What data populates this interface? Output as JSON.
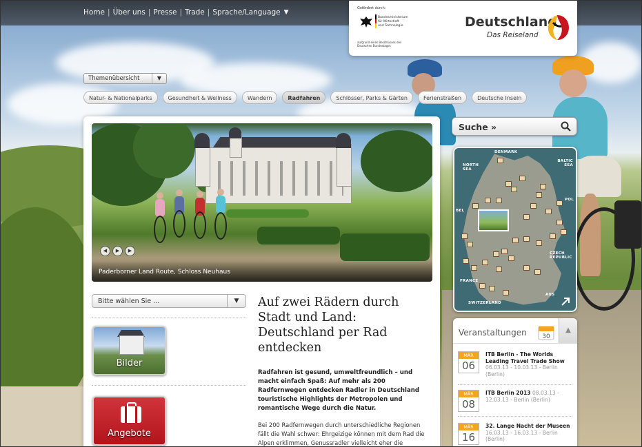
{
  "topnav": {
    "items": [
      "Home",
      "Über uns",
      "Presse",
      "Trade",
      "Sprache/Language"
    ]
  },
  "brand": {
    "funded_by": "Gefördert durch:",
    "ministry": "Bundesministerium für Wirtschaft und Technologie",
    "decision_note": "aufgrund eines Beschlusses des Deutschen Bundestages",
    "title": "Deutschland",
    "subtitle": "Das Reiseland"
  },
  "themes": {
    "selector_label": "Themenübersicht",
    "pills": [
      "Natur- & Nationalparks",
      "Gesundheit & Wellness",
      "Wandern",
      "Radfahren",
      "Schlösser, Parks & Gärten",
      "Ferienstraßen",
      "Deutsche Inseln"
    ],
    "active": "Radfahren"
  },
  "hero": {
    "caption": "Paderborner Land Route, Schloss Neuhaus"
  },
  "select": {
    "label": "Bitte wählen Sie ..."
  },
  "tiles": {
    "bilder": "Bilder",
    "angebote": "Angebote"
  },
  "article": {
    "title": "Auf zwei Rädern durch Stadt und Land: Deutschland per Rad entdecken",
    "lead": "Radfahren ist gesund, umweltfreundlich – und macht einfach Spaß: Auf mehr als 200 Radfernwegen entdecken Radler in Deutschland touristische Highlights der Metropolen und romantische Wege durch die Natur.",
    "body": "Bei 200 Radfernwegen durch unterschiedliche Regionen fällt die Wahl schwer: Ehrgeizige können mit dem Rad die Alpen erklimmen, Genussradler vielleicht eher die"
  },
  "search": {
    "label": "Suche »"
  },
  "map": {
    "labels": {
      "denmark": "DENMARK",
      "north_sea": "NORTH SEA",
      "baltic_sea": "BALTIC SEA",
      "pol": "POL",
      "czech": "CZECH REPUBLIC",
      "france": "FRANCE",
      "switzerland": "SWITZERLAND",
      "aus": "AUS",
      "bel": "BEL"
    }
  },
  "events": {
    "title": "Veranstaltungen",
    "calendar_day": "30",
    "items": [
      {
        "month": "MÄR",
        "day": "06",
        "name": "ITB Berlin - The Worlds Leading Travel Trade Show",
        "details": "06.03.13 - 10.03.13 - Berlin (Berlin)"
      },
      {
        "month": "MÄR",
        "day": "08",
        "name": "ITB Berlin 2013",
        "details": "08.03.13 - 12.03.13 - Berlin (Berlin)"
      },
      {
        "month": "MÄR",
        "day": "16",
        "name": "32. Lange Nacht der Museen",
        "details": "16.03.13 - 16.03.13 - Berlin (Berlin)"
      }
    ]
  },
  "colors": {
    "accent_red": "#b3141c",
    "event_orange": "#f3a521",
    "nav_dark": "#3a4048"
  }
}
